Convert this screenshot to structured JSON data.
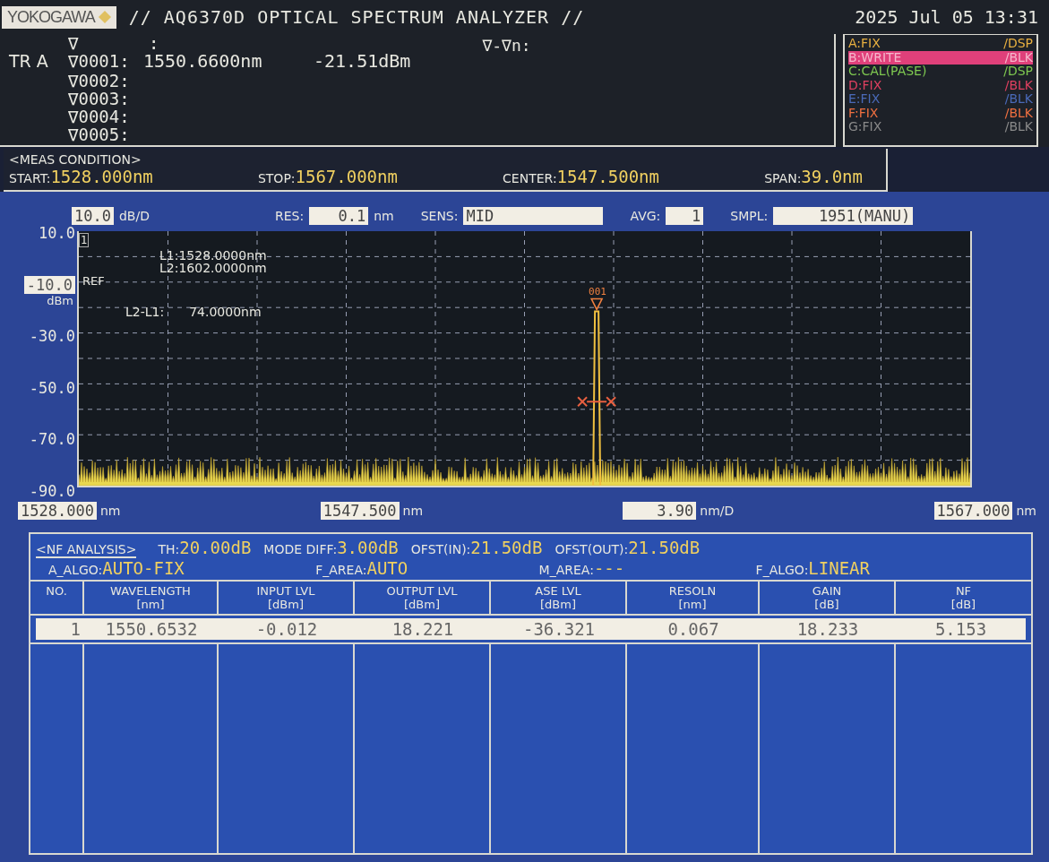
{
  "header": {
    "logo": "YOKOGAWA",
    "title": "// AQ6370D OPTICAL SPECTRUM ANALYZER //",
    "datetime": "2025 Jul 05 13:31"
  },
  "markers": {
    "trace_label": "TR A",
    "head_symbol": "∇",
    "head_colon": ":",
    "delta_label": "∇-∇n:",
    "rows": [
      {
        "label": "∇0001:",
        "wavelength": "1550.6600nm",
        "level": "-21.51dBm"
      },
      {
        "label": "∇0002:"
      },
      {
        "label": "∇0003:"
      },
      {
        "label": "∇0004:"
      },
      {
        "label": "∇0005:"
      }
    ]
  },
  "traces": [
    {
      "name": "A:FIX",
      "display": "/DSP",
      "color": "#e8b040",
      "selected": false
    },
    {
      "name": "B:WRITE",
      "display": "/BLK",
      "color": "#e0407a",
      "selected": true
    },
    {
      "name": "C:CAL(PASE)",
      "display": "/DSP",
      "color": "#7ec850",
      "selected": false
    },
    {
      "name": "D:FIX",
      "display": "/BLK",
      "color": "#e04060",
      "selected": false
    },
    {
      "name": "E:FIX",
      "display": "/BLK",
      "color": "#4a6ab8",
      "selected": false
    },
    {
      "name": "F:FIX",
      "display": "/BLK",
      "color": "#f07040",
      "selected": false
    },
    {
      "name": "G:FIX",
      "display": "/BLK",
      "color": "#8a8a8a",
      "selected": false
    }
  ],
  "meas_condition": {
    "title": "<MEAS CONDITION>",
    "items": [
      {
        "label": "START:",
        "value": "1528.000nm"
      },
      {
        "label": "STOP:",
        "value": "1567.000nm"
      },
      {
        "label": "CENTER:",
        "value": "1547.500nm"
      },
      {
        "label": "SPAN:",
        "value": "39.0nm"
      }
    ]
  },
  "settings": [
    {
      "value": "10.0",
      "unit": "dB/D",
      "kind": "scale"
    },
    {
      "label": "RES:",
      "value": "0.1",
      "unit": "nm",
      "kind": "field"
    },
    {
      "label": "SENS:",
      "value": "MID",
      "kind": "field"
    },
    {
      "label": "AVG:",
      "value": "1",
      "kind": "field"
    },
    {
      "label": "SMPL:",
      "value": "1951(MANU)",
      "kind": "field"
    }
  ],
  "chart": {
    "y_labels": [
      {
        "text": "10.0",
        "ref": false
      },
      {
        "text": "-10.0",
        "ref": true
      },
      {
        "text": "-30.0",
        "ref": false
      },
      {
        "text": "-50.0",
        "ref": false
      },
      {
        "text": "-70.0",
        "ref": false
      },
      {
        "text": "-90.0",
        "ref": false
      }
    ],
    "ref_unit": "dBm",
    "trace_number": "1",
    "ref_label": "REF",
    "line_markers": [
      "L1:1528.0000nm",
      "L2:1602.0000nm"
    ],
    "delta_label": "L2-L1:",
    "delta_value": "74.0000nm",
    "peak_label": "001"
  },
  "x_axis": [
    {
      "value": "1528.000",
      "unit": "nm"
    },
    {
      "value": "1547.500",
      "unit": "nm"
    },
    {
      "value": "3.90",
      "unit": "nm/D"
    },
    {
      "value": "1567.000",
      "unit": "nm"
    }
  ],
  "nf_analysis": {
    "title": "<NF ANALYSIS>",
    "params": [
      {
        "label": "TH:",
        "value": "20.00dB"
      },
      {
        "label": "MODE DIFF:",
        "value": "3.00dB"
      },
      {
        "label": "OFST(IN):",
        "value": "21.50dB"
      },
      {
        "label": "OFST(OUT):",
        "value": "21.50dB"
      }
    ],
    "params2": [
      {
        "label": "A_ALGO:",
        "value": "AUTO-FIX"
      },
      {
        "label": "F_AREA:",
        "value": "AUTO"
      },
      {
        "label": "M_AREA:",
        "value": "---"
      },
      {
        "label": "F_ALGO:",
        "value": "LINEAR"
      }
    ],
    "columns": [
      {
        "name": "NO."
      },
      {
        "name": "WAVELENGTH",
        "unit": "[nm]"
      },
      {
        "name": "INPUT LVL",
        "unit": "[dBm]"
      },
      {
        "name": "OUTPUT LVL",
        "unit": "[dBm]"
      },
      {
        "name": "ASE LVL",
        "unit": "[dBm]"
      },
      {
        "name": "RESOLN",
        "unit": "[nm]"
      },
      {
        "name": "GAIN",
        "unit": "[dB]"
      },
      {
        "name": "NF",
        "unit": "[dB]"
      }
    ],
    "rows": [
      {
        "selected": true,
        "cells": [
          "1",
          "1550.6532",
          "-0.012",
          "18.221",
          "-36.321",
          "0.067",
          "18.233",
          "5.153"
        ]
      }
    ]
  }
}
